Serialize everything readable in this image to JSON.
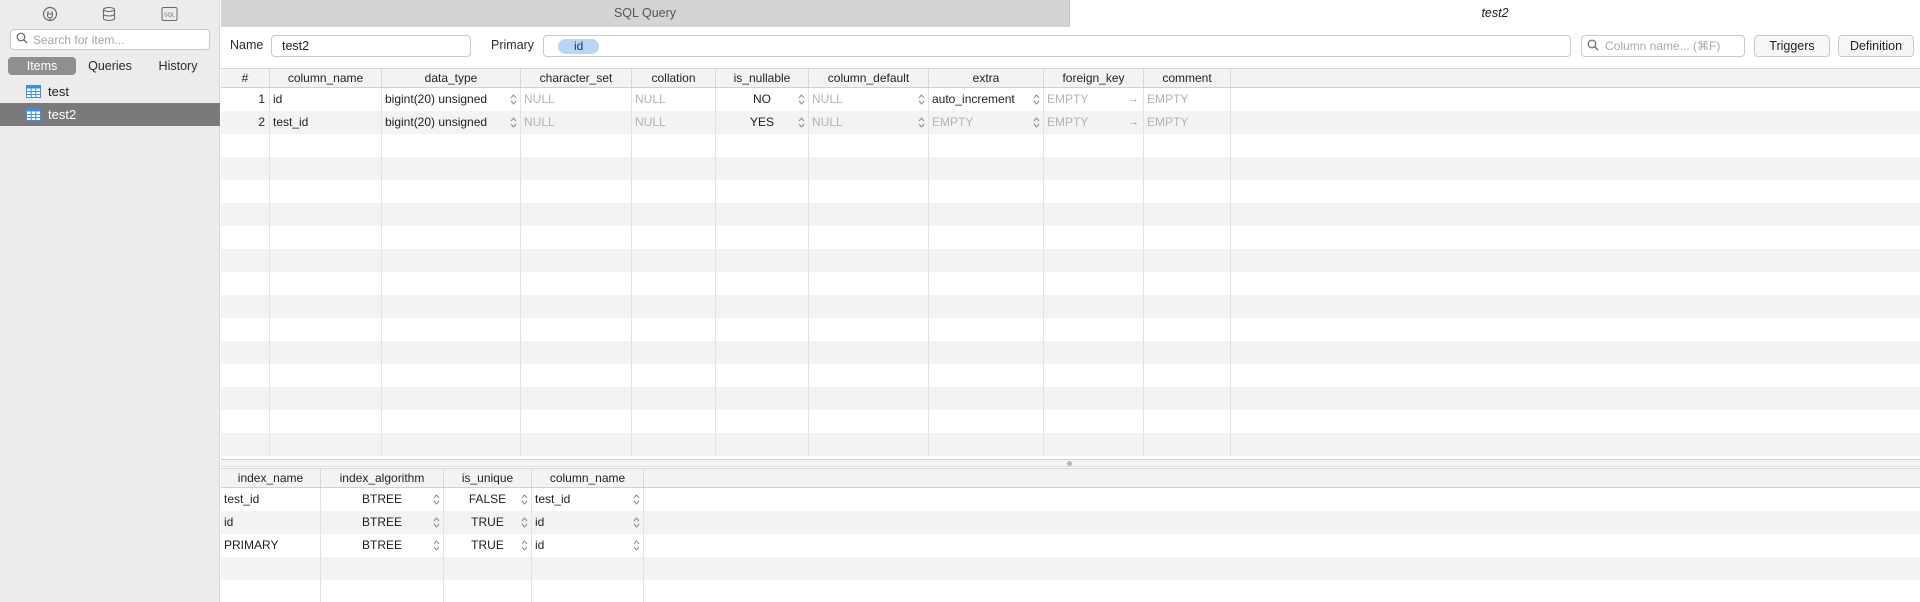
{
  "sidebar": {
    "search_placeholder": "Search for item...",
    "segments": [
      {
        "label": "Items",
        "active": true
      },
      {
        "label": "Queries",
        "active": false
      },
      {
        "label": "History",
        "active": false
      }
    ],
    "items": [
      {
        "label": "test",
        "icon": "table-icon",
        "selected": false
      },
      {
        "label": "test2",
        "icon": "table-icon",
        "selected": true
      }
    ],
    "top_icons": [
      "plug-icon",
      "database-icon",
      "sql-icon"
    ],
    "top_icon_sql_text": "SQL"
  },
  "tabs": [
    {
      "label": "SQL Query",
      "active": false
    },
    {
      "label": "test2",
      "active": true
    }
  ],
  "toolbar": {
    "name_label": "Name",
    "name_value": "test2",
    "primary_label": "Primary",
    "primary_value": "id",
    "column_search_placeholder": "Column name... (⌘F)",
    "triggers_label": "Triggers",
    "definition_label": "Definition"
  },
  "columns_table": {
    "headers": [
      "#",
      "column_name",
      "data_type",
      "character_set",
      "collation",
      "is_nullable",
      "column_default",
      "extra",
      "foreign_key",
      "comment"
    ],
    "rows": [
      {
        "num": "1",
        "column_name": "id",
        "data_type": "bigint(20) unsigned",
        "character_set": "NULL",
        "collation": "NULL",
        "is_nullable": "NO",
        "column_default": "NULL",
        "extra": "auto_increment",
        "foreign_key": "EMPTY",
        "comment": "EMPTY"
      },
      {
        "num": "2",
        "column_name": "test_id",
        "data_type": "bigint(20) unsigned",
        "character_set": "NULL",
        "collation": "NULL",
        "is_nullable": "YES",
        "column_default": "NULL",
        "extra": "EMPTY",
        "foreign_key": "EMPTY",
        "comment": "EMPTY"
      }
    ]
  },
  "index_table": {
    "headers": [
      "index_name",
      "index_algorithm",
      "is_unique",
      "column_name"
    ],
    "rows": [
      {
        "index_name": "test_id",
        "index_algorithm": "BTREE",
        "is_unique": "FALSE",
        "column_name": "test_id"
      },
      {
        "index_name": "id",
        "index_algorithm": "BTREE",
        "is_unique": "TRUE",
        "column_name": "id"
      },
      {
        "index_name": "PRIMARY",
        "index_algorithm": "BTREE",
        "is_unique": "TRUE",
        "column_name": "id"
      }
    ]
  },
  "colors": {
    "accent_pill": "#b7d6f5",
    "selected_row": "#7a7a7a",
    "table_icon": "#3d8ee6"
  }
}
